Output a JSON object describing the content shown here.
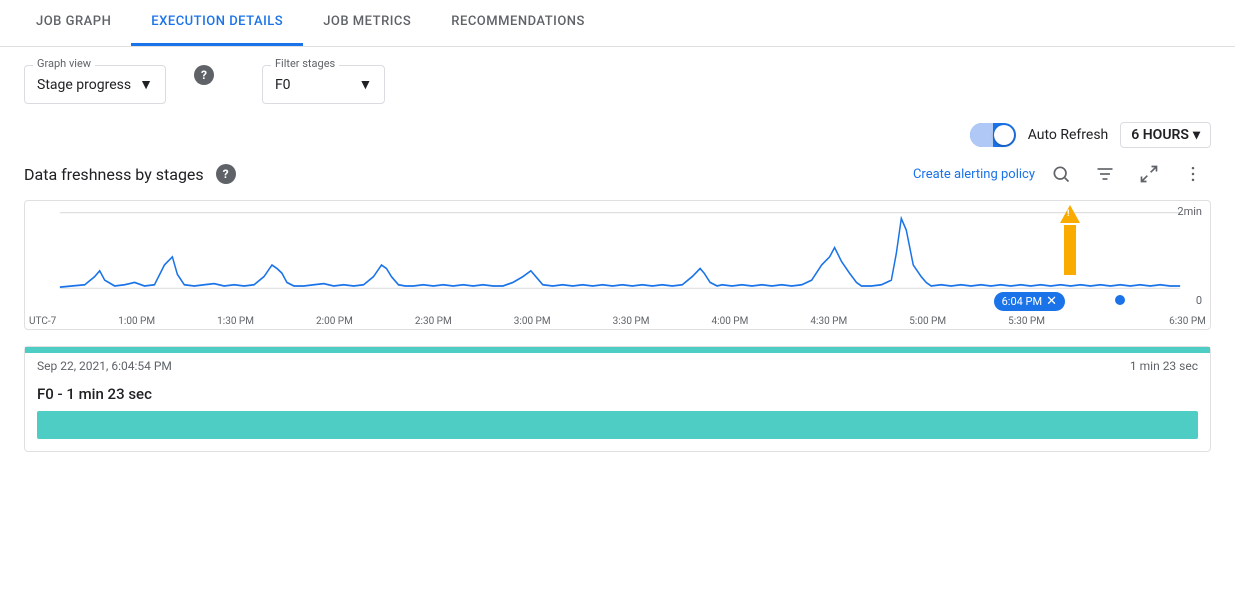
{
  "tabs": [
    {
      "id": "job-graph",
      "label": "JOB GRAPH",
      "active": false
    },
    {
      "id": "execution-details",
      "label": "EXECUTION DETAILS",
      "active": true
    },
    {
      "id": "job-metrics",
      "label": "JOB METRICS",
      "active": false
    },
    {
      "id": "recommendations",
      "label": "RECOMMENDATIONS",
      "active": false
    }
  ],
  "controls": {
    "graph_view_label": "Graph view",
    "graph_view_value": "Stage progress",
    "filter_stages_label": "Filter stages",
    "filter_stages_value": "F0"
  },
  "auto_refresh": {
    "label": "Auto Refresh",
    "hours_label": "6 HOURS"
  },
  "chart": {
    "title": "Data freshness by stages",
    "help_icon": "?",
    "create_alert_text": "Create alerting policy",
    "y_top_label": "2min",
    "y_bottom_label": "0",
    "x_labels": [
      "UTC-7",
      "1:00 PM",
      "1:30 PM",
      "2:00 PM",
      "2:30 PM",
      "3:00 PM",
      "3:30 PM",
      "4:00 PM",
      "4:30 PM",
      "5:00 PM",
      "5:30 PM",
      "6:04 PM",
      "6:30 PM"
    ],
    "time_chip": "6:04 PM"
  },
  "bottom": {
    "timestamp": "Sep 22, 2021, 6:04:54 PM",
    "duration": "1 min 23 sec",
    "stage_label": "F0 - 1 min 23 sec"
  },
  "icons": {
    "dropdown": "▼",
    "help": "?",
    "search": "🔍",
    "filter_lines": "≡",
    "fullscreen": "⛶",
    "more_vert": "⋮",
    "close": "✕",
    "chevron_down": "▾"
  }
}
